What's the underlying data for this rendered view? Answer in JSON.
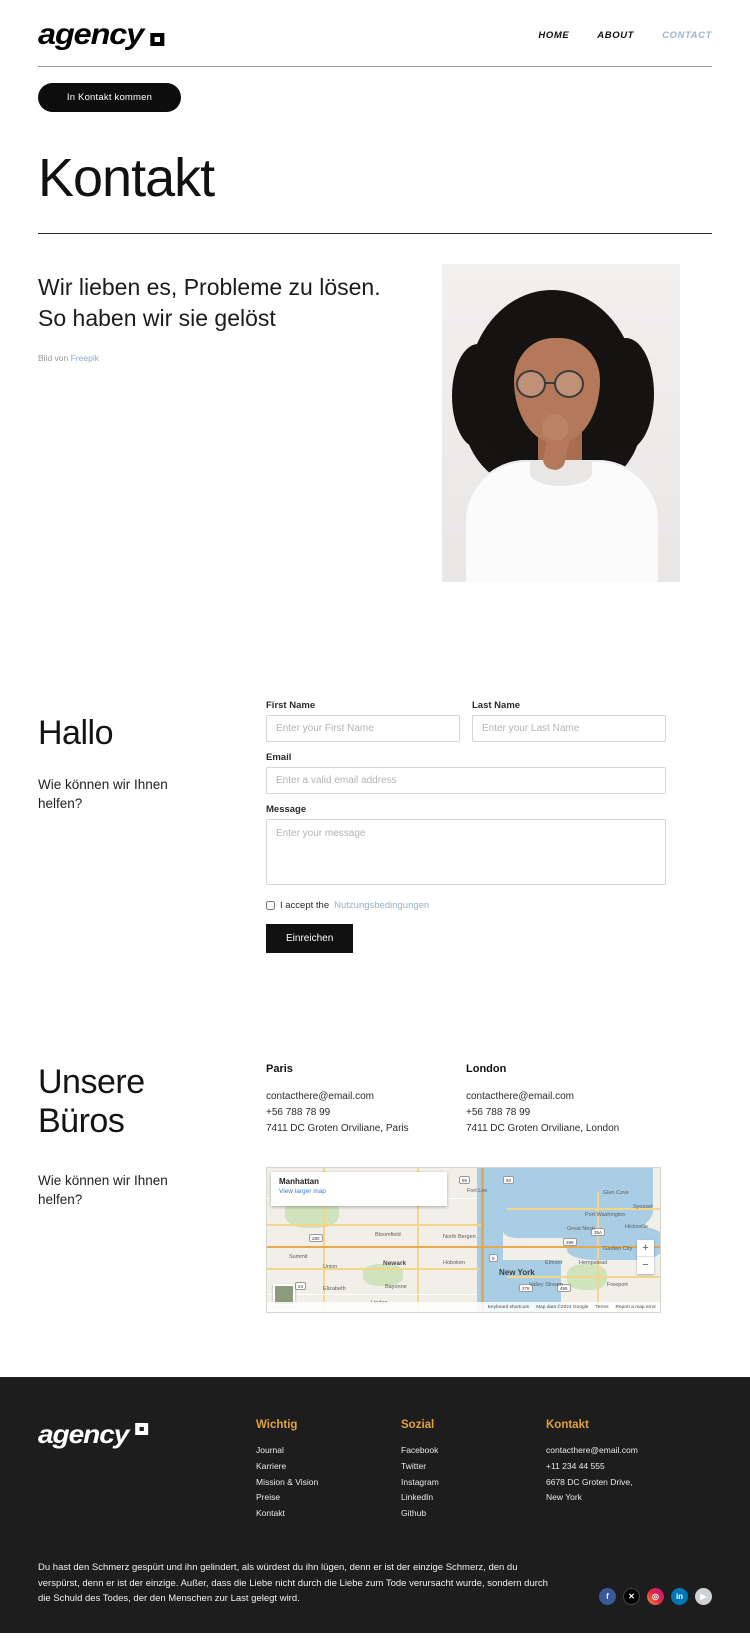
{
  "header": {
    "logo_text": "agency",
    "nav": [
      {
        "label": "HOME",
        "active": false
      },
      {
        "label": "ABOUT",
        "active": false
      },
      {
        "label": "CONTACT",
        "active": true
      }
    ]
  },
  "cta": {
    "label": "In Kontakt kommen"
  },
  "hero": {
    "title": "Kontakt",
    "intro_heading": "Wir lieben es, Probleme zu lösen. So haben wir sie gelöst",
    "credit_prefix": "Bild von ",
    "credit_link": "Freepik"
  },
  "form": {
    "heading": "Hallo",
    "subtext": "Wie können wir Ihnen helfen?",
    "first_name_label": "First Name",
    "first_name_placeholder": "Enter your First Name",
    "last_name_label": "Last Name",
    "last_name_placeholder": "Enter your Last Name",
    "email_label": "Email",
    "email_placeholder": "Enter a valid email address",
    "message_label": "Message",
    "message_placeholder": "Enter your message",
    "accept_prefix": "I accept the ",
    "accept_link": "Nutzungsbedingungen",
    "submit_label": "Einreichen"
  },
  "offices": {
    "heading": "Unsere Büros",
    "subtext": "Wie können wir Ihnen helfen?",
    "locations": [
      {
        "city": "Paris",
        "email": "contacthere@email.com",
        "phone": "+56 788 78 99",
        "address": "7411 DC Groten Orviliane, Paris"
      },
      {
        "city": "London",
        "email": "contacthere@email.com",
        "phone": "+56 788 78 99",
        "address": "7411 DC Groten Orviliane, London"
      }
    ]
  },
  "map": {
    "card_title": "Manhattan",
    "card_link": "View larger map",
    "zoom_in": "+",
    "zoom_out": "−",
    "labels": [
      "Glen Cove",
      "Port Washington",
      "Great Neck",
      "Fort Lee",
      "Bloomfield",
      "North Bergen",
      "Hoboken",
      "Newark",
      "New York",
      "Elmont",
      "Hempstead",
      "Garden City",
      "Valley Stream",
      "Freeport",
      "Summit",
      "Union",
      "Elizabeth",
      "Bayonne",
      "Linden",
      "Syosset",
      "Hicksville"
    ],
    "footer": {
      "shortcuts": "Keyboard shortcuts",
      "data": "Map data ©2024 Google",
      "terms": "Terms",
      "report": "Report a map error"
    }
  },
  "footer": {
    "logo_text": "agency",
    "columns": [
      {
        "title": "Wichtig",
        "links": [
          "Journal",
          "Karriere",
          "Mission & Vision",
          "Preise",
          "Kontakt"
        ]
      },
      {
        "title": "Sozial",
        "links": [
          "Facebook",
          "Twitter",
          "Instagram",
          "LinkedIn",
          "Github"
        ]
      },
      {
        "title": "Kontakt",
        "links": [
          "contacthere@email.com",
          "+11 234 44 555",
          "6678 DC Groten Drive,",
          "New York"
        ]
      }
    ],
    "legal": "Du hast den Schmerz gespürt und ihn gelindert, als würdest du ihn lügen, denn er ist der einzige Schmerz, den du verspürst, denn er ist der einzige. Außer, dass die Liebe nicht durch die Liebe zum Tode verursacht wurde, sondern durch die Schuld des Todes, der den Menschen zur Last gelegt wird.",
    "social": [
      {
        "name": "facebook",
        "glyph": "f"
      },
      {
        "name": "x-twitter",
        "glyph": "✕"
      },
      {
        "name": "instagram",
        "glyph": "◎"
      },
      {
        "name": "linkedin",
        "glyph": "in"
      },
      {
        "name": "youtube",
        "glyph": "▶"
      }
    ]
  },
  "colors": {
    "accent_orange": "#e0a040",
    "link_blue": "#97b0c6",
    "footer_bg": "#1d1d1d"
  }
}
